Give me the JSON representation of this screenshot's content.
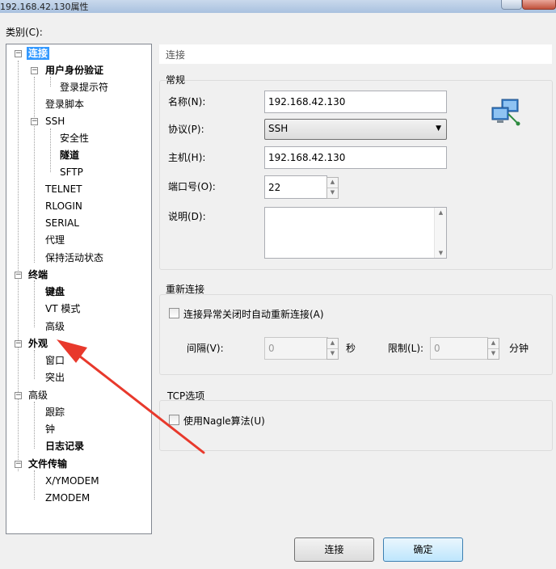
{
  "window": {
    "title": "192.168.42.130属性"
  },
  "category_label": "类别(C):",
  "tree": [
    {
      "label": "连接",
      "bold": true,
      "selected": true
    },
    {
      "label": "用户身份验证",
      "bold": true
    },
    {
      "label": "登录提示符"
    },
    {
      "label": "登录脚本"
    },
    {
      "label": "SSH"
    },
    {
      "label": "安全性"
    },
    {
      "label": "隧道",
      "bold": true
    },
    {
      "label": "SFTP"
    },
    {
      "label": "TELNET"
    },
    {
      "label": "RLOGIN"
    },
    {
      "label": "SERIAL"
    },
    {
      "label": "代理"
    },
    {
      "label": "保持活动状态"
    },
    {
      "label": "终端",
      "bold": true
    },
    {
      "label": "键盘",
      "bold": true
    },
    {
      "label": "VT 模式"
    },
    {
      "label": "高级"
    },
    {
      "label": "外观",
      "bold": true
    },
    {
      "label": "窗口"
    },
    {
      "label": "突出"
    },
    {
      "label": "高级"
    },
    {
      "label": "跟踪"
    },
    {
      "label": "钟"
    },
    {
      "label": "日志记录",
      "bold": true
    },
    {
      "label": "文件传输",
      "bold": true
    },
    {
      "label": "X/YMODEM"
    },
    {
      "label": "ZMODEM"
    }
  ],
  "panel": {
    "header": "连接",
    "general": {
      "title": "常规",
      "name_label": "名称(N):",
      "name_value": "192.168.42.130",
      "protocol_label": "协议(P):",
      "protocol_value": "SSH",
      "host_label": "主机(H):",
      "host_value": "192.168.42.130",
      "port_label": "端口号(O):",
      "port_value": "22",
      "desc_label": "说明(D):"
    },
    "reconnect": {
      "title": "重新连接",
      "checkbox_label": "连接异常关闭时自动重新连接(A)",
      "interval_label": "间隔(V):",
      "interval_value": "0",
      "interval_unit": "秒",
      "limit_label": "限制(L):",
      "limit_value": "0",
      "limit_unit": "分钟"
    },
    "tcp": {
      "title": "TCP选项",
      "nagle_label": "使用Nagle算法(U)"
    }
  },
  "buttons": {
    "connect": "连接",
    "ok": "确定"
  },
  "colors": {
    "selection": "#3399ff",
    "annotation_arrow": "#e8392c"
  }
}
